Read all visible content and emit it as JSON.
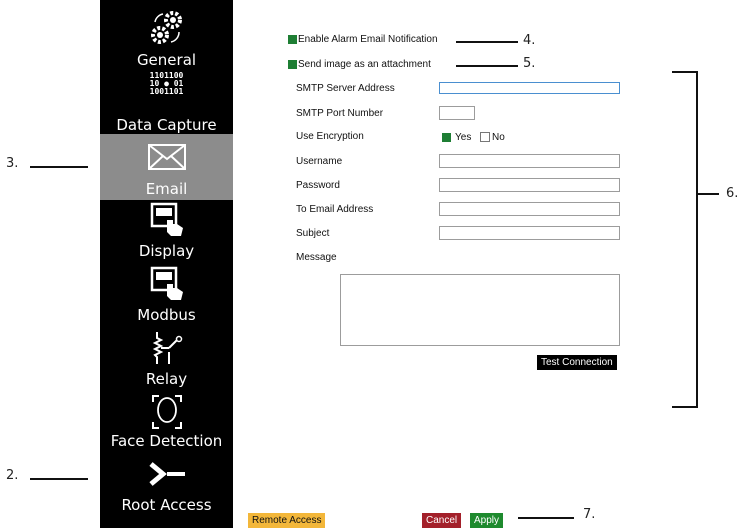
{
  "sidebar": {
    "items": [
      {
        "label": "General",
        "icon": "gears-icon"
      },
      {
        "label": "Data Capture",
        "icon": "binary-person-icon",
        "icon_text": [
          "1101100",
          "10",
          "01",
          "1001101"
        ]
      },
      {
        "label": "Email",
        "icon": "envelope-icon",
        "active": true
      },
      {
        "label": "Display",
        "icon": "touch-screen-icon"
      },
      {
        "label": "Modbus",
        "icon": "touch-screen-icon"
      },
      {
        "label": "Relay",
        "icon": "relay-switch-icon"
      },
      {
        "label": "Face Detection",
        "icon": "face-frame-icon"
      },
      {
        "label": "Root Access",
        "icon": "terminal-prompt-icon"
      }
    ]
  },
  "form": {
    "enable_alarm_label": "Enable Alarm Email Notification",
    "send_image_label": "Send image as an attachment",
    "smtp_server_label": "SMTP Server Address",
    "smtp_server_value": "",
    "smtp_port_label": "SMTP Port Number",
    "smtp_port_value": "",
    "encryption_label": "Use Encryption",
    "encryption_yes": "Yes",
    "encryption_no": "No",
    "username_label": "Username",
    "username_value": "",
    "password_label": "Password",
    "password_value": "",
    "to_email_label": "To Email Address",
    "to_email_value": "",
    "subject_label": "Subject",
    "subject_value": "",
    "message_label": "Message",
    "message_value": "",
    "test_connection": "Test Connection"
  },
  "footer": {
    "remote_access": "Remote Access",
    "cancel": "Cancel",
    "apply": "Apply"
  },
  "callouts": {
    "c2": "2.",
    "c3": "3.",
    "c4": "4.",
    "c5": "5.",
    "c6": "6.",
    "c7": "7."
  },
  "colors": {
    "sidebar_bg": "#000000",
    "active_bg": "#8c8c8c",
    "checkbox_green": "#1e7e34",
    "remote_access_bg": "#f3b73a",
    "cancel_bg": "#a3202a",
    "apply_bg": "#1e8a2e"
  }
}
